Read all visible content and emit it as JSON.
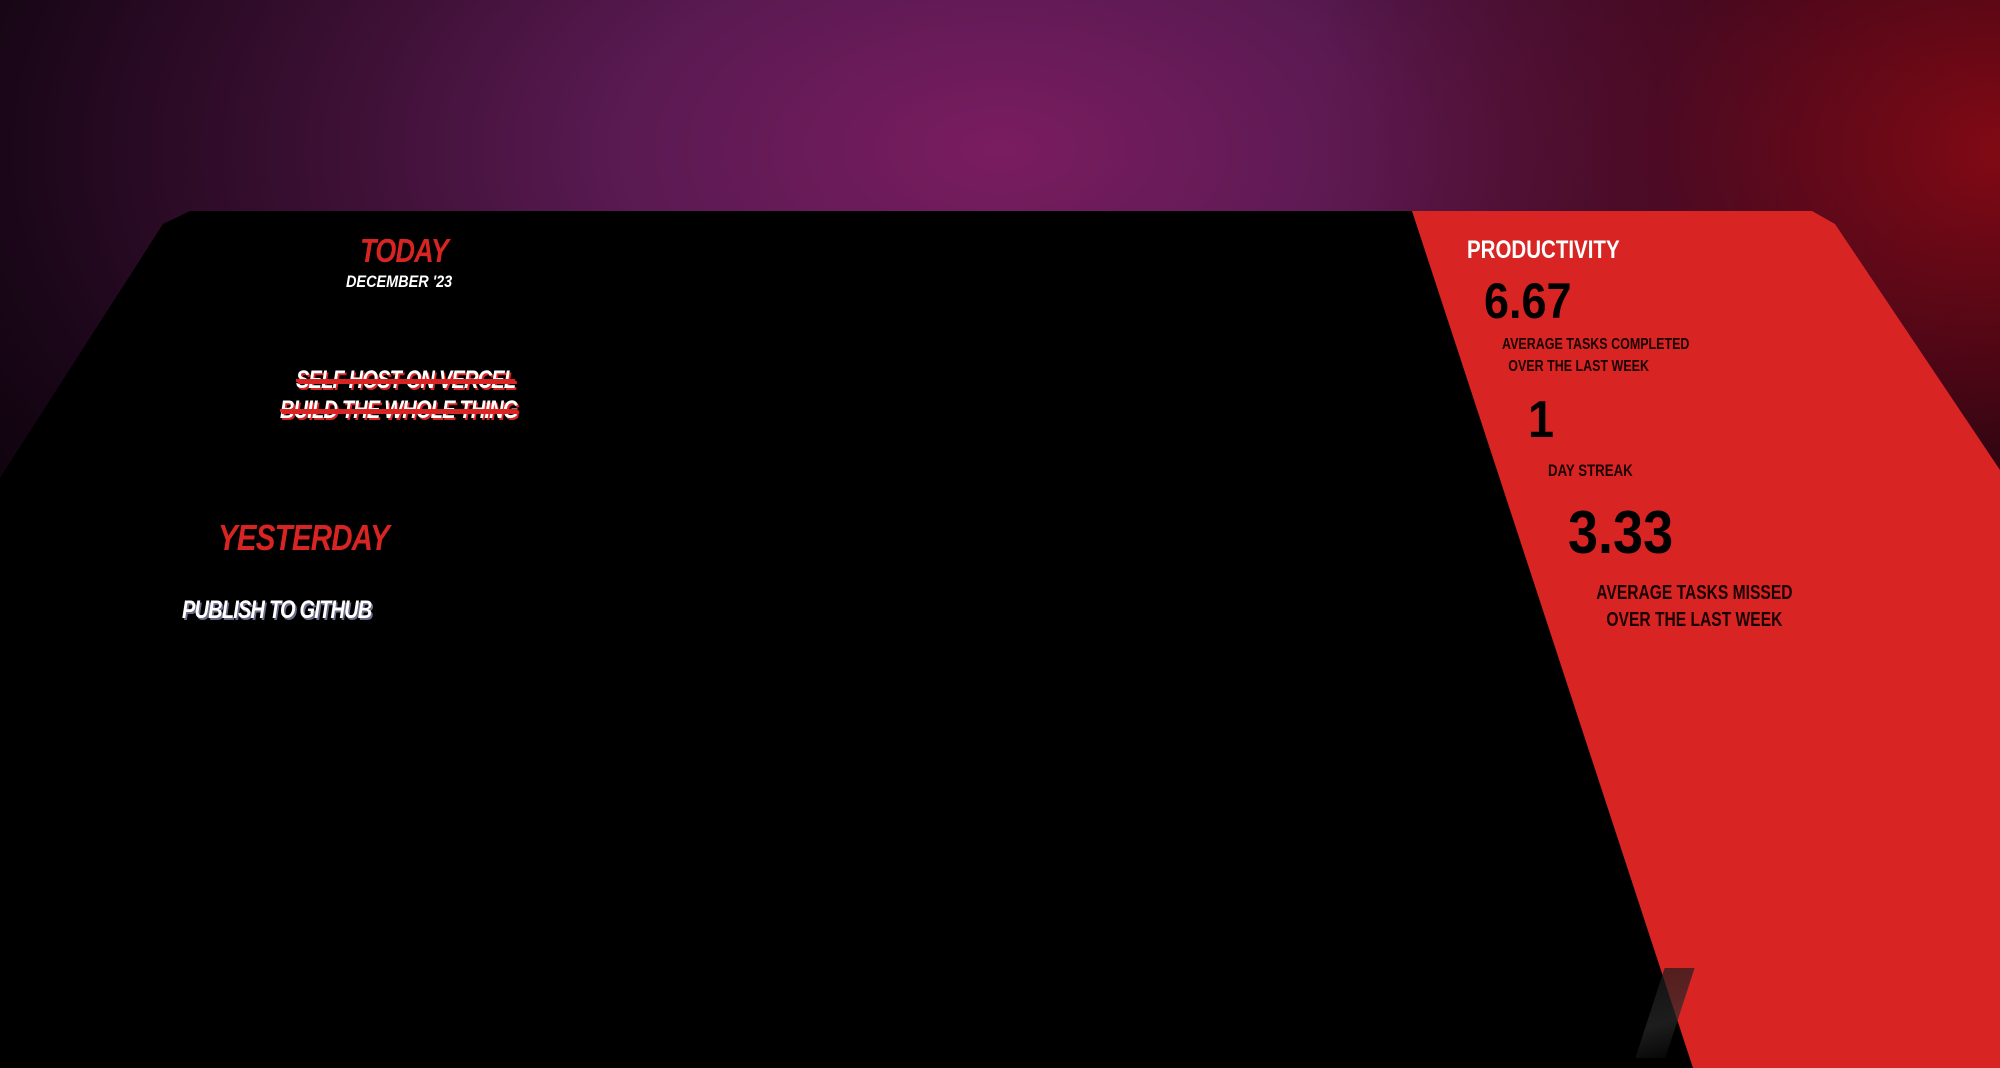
{
  "today": {
    "title": "TODAY",
    "date": "DECEMBER '23",
    "tasks": [
      {
        "label": "SELF HOST ON VERCEL",
        "done": true
      },
      {
        "label": "BUILD THE WHOLE THING",
        "done": true
      }
    ]
  },
  "yesterday": {
    "title": "YESTERDAY",
    "tasks": [
      {
        "label": "PUBLISH TO GITHUB",
        "done": false
      }
    ]
  },
  "productivity": {
    "title": "PRODUCTIVITY",
    "stats": [
      {
        "value": "6.67",
        "label_line1": "AVERAGE TASKS COMPLETED",
        "label_line2": "OVER THE LAST WEEK"
      },
      {
        "value": "1",
        "label_line1": "DAY STREAK",
        "label_line2": ""
      },
      {
        "value": "3.33",
        "label_line1": "AVERAGE TASKS MISSED",
        "label_line2": "OVER THE LAST WEEK"
      }
    ]
  },
  "colors": {
    "accent_red": "#d92424",
    "panel_black": "#000000",
    "text_white": "#ffffff",
    "bg_purple": "#7a1c60"
  }
}
